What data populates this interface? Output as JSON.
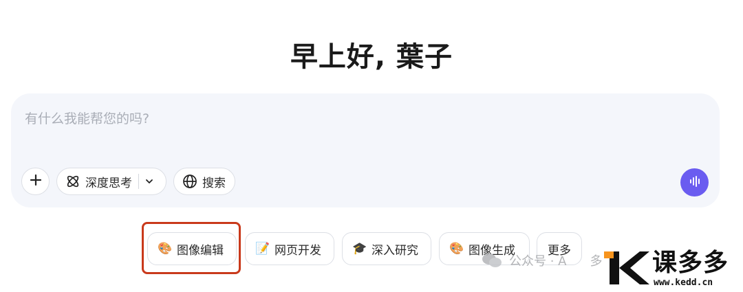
{
  "greeting": "早上好, 葉子",
  "composer": {
    "placeholder": "有什么我能帮您的吗?",
    "add_label": "+",
    "deep_think_label": "深度思考",
    "search_label": "搜索",
    "accent_color": "#6a5cf0",
    "icons": {
      "add": "plus-icon",
      "deep_think": "atom-icon",
      "dropdown": "chevron-down-icon",
      "search": "globe-icon",
      "voice": "voice-wave-icon"
    }
  },
  "suggestions": [
    {
      "emoji": "🎨",
      "label": "图像编辑",
      "icon": "paint-pencil-icon"
    },
    {
      "emoji": "📝",
      "label": "网页开发",
      "icon": "memo-icon"
    },
    {
      "emoji": "🎓",
      "label": "深入研究",
      "icon": "graduation-cap-icon"
    },
    {
      "emoji": "🎨",
      "label": "图像生成",
      "icon": "palette-icon"
    },
    {
      "emoji": "",
      "label": "更多",
      "icon": ""
    }
  ],
  "highlight_color": "#c9391b",
  "watermark": {
    "text": "公众号 · A",
    "tail": "多",
    "icon": "wechat-icon"
  },
  "logo": {
    "name": "课多多",
    "url": "www.kedd.cn",
    "colors": {
      "mark": "#111111",
      "accent": "#f7941d"
    }
  }
}
